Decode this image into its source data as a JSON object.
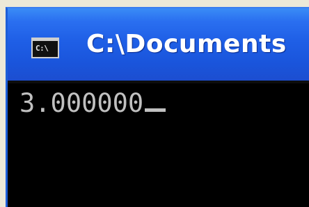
{
  "window": {
    "title": "C:\\Documents",
    "icon_label": "C:\\",
    "icon_name": "console-icon"
  },
  "console": {
    "output": "3.000000"
  },
  "colors": {
    "titlebar": "#1f5fe6",
    "console_bg": "#000000",
    "console_text": "#c0c0c0"
  }
}
